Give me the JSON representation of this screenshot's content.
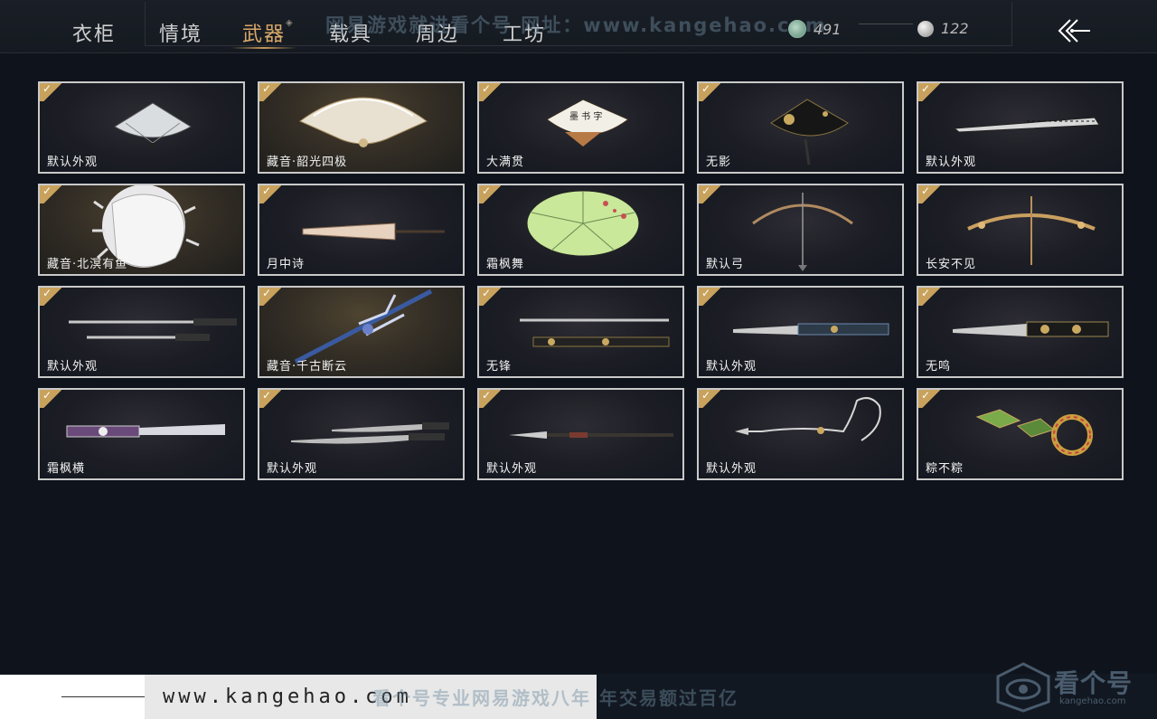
{
  "tabs": [
    {
      "label": "衣柜"
    },
    {
      "label": "情境"
    },
    {
      "label": "武器",
      "active": true
    },
    {
      "label": "载具"
    },
    {
      "label": "周边"
    },
    {
      "label": "工坊"
    }
  ],
  "currency": {
    "jade": "491",
    "silver": "122"
  },
  "watermark_top": "网易游戏就进看个号  网址：www.kangehao.com",
  "watermark_bottom": "看个号专业网易游戏八年  年交易额过百亿",
  "url_text": "www.kangehao.com",
  "logo": {
    "main": "看个号",
    "sub": "kangehao.com"
  },
  "items": [
    {
      "name": "默认外观",
      "icon": "folding-fan",
      "bg": "dark",
      "owned": true
    },
    {
      "name": "藏音·韶光四极",
      "icon": "ornate-fan",
      "bg": "gold",
      "owned": true
    },
    {
      "name": "大满贯",
      "icon": "calligraphy-fan",
      "bg": "dark",
      "owned": true
    },
    {
      "name": "无影",
      "icon": "black-gold-fan",
      "bg": "dark",
      "owned": true
    },
    {
      "name": "默认外观",
      "icon": "closed-fan",
      "bg": "dark",
      "owned": true
    },
    {
      "name": "藏音·北溟有鱼",
      "icon": "white-fish-fan",
      "bg": "gold",
      "owned": true
    },
    {
      "name": "月中诗",
      "icon": "closed-umbrella",
      "bg": "dark",
      "owned": true
    },
    {
      "name": "霜枫舞",
      "icon": "green-umbrella",
      "bg": "dark",
      "owned": true
    },
    {
      "name": "默认弓",
      "icon": "bow",
      "bg": "dark",
      "owned": true
    },
    {
      "name": "长安不见",
      "icon": "golden-bow",
      "bg": "dark",
      "owned": true
    },
    {
      "name": "默认外观",
      "icon": "twin-swords",
      "bg": "dark",
      "owned": true
    },
    {
      "name": "藏音·千古断云",
      "icon": "blue-spear",
      "bg": "gold",
      "owned": true
    },
    {
      "name": "无锋",
      "icon": "sword-scabbard",
      "bg": "dark",
      "owned": true
    },
    {
      "name": "默认外观",
      "icon": "long-blade",
      "bg": "dark",
      "owned": true
    },
    {
      "name": "无鸣",
      "icon": "ornate-blade",
      "bg": "dark",
      "owned": true
    },
    {
      "name": "霜枫横",
      "icon": "purple-blade",
      "bg": "dark",
      "owned": true
    },
    {
      "name": "默认外观",
      "icon": "twin-sabers",
      "bg": "dark",
      "owned": true
    },
    {
      "name": "默认外观",
      "icon": "spear",
      "bg": "dark",
      "owned": true
    },
    {
      "name": "默认外观",
      "icon": "rope-dart",
      "bg": "dark",
      "owned": true
    },
    {
      "name": "粽不粽",
      "icon": "festive-dart",
      "bg": "dark",
      "owned": true
    }
  ],
  "colors": {
    "accent": "#d9a86a",
    "check": "#c8a25c",
    "card_border": "#c9c9c9"
  }
}
